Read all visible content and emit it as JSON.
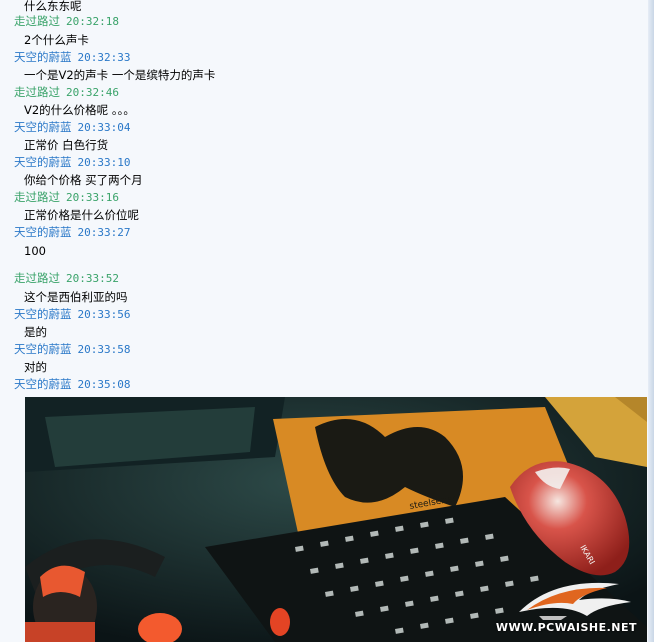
{
  "colors": {
    "sender_a": "#3aa36a",
    "sender_b": "#2a78c8",
    "background": "#f5f8fc"
  },
  "messages": [
    {
      "text": "什么东东呢"
    },
    {
      "sender": "走过路过",
      "time": "20:32:18",
      "text": "2个什么声卡"
    },
    {
      "sender": "天空的蔚蓝",
      "time": "20:32:33",
      "text": "一个是V2的声卡 一个是缤特力的声卡"
    },
    {
      "sender": "走过路过",
      "time": "20:32:46",
      "text": "V2的什么价格呢 。。。"
    },
    {
      "sender": "天空的蔚蓝",
      "time": "20:33:04",
      "text": "正常价 白色行货"
    },
    {
      "sender": "天空的蔚蓝",
      "time": "20:33:10",
      "text": "你给个价格 买了两个月"
    },
    {
      "sender": "走过路过",
      "time": "20:33:16",
      "text": "正常价格是什么价位呢"
    },
    {
      "sender": "天空的蔚蓝",
      "time": "20:33:27",
      "text": "100"
    },
    {
      "sender": "走过路过",
      "time": "20:33:52",
      "text": "这个是西伯利亚的吗"
    },
    {
      "sender": "天空的蔚蓝",
      "time": "20:33:56",
      "text": "是的"
    },
    {
      "sender": "天空的蔚蓝",
      "time": "20:33:58",
      "text": "对的"
    },
    {
      "sender": "天空的蔚蓝",
      "time": "20:35:08"
    }
  ],
  "photo": {
    "keyboard_brand": "steelseries",
    "mouse_label": "IKARI",
    "watermark": "WWW.PCWAISHE.NET"
  }
}
